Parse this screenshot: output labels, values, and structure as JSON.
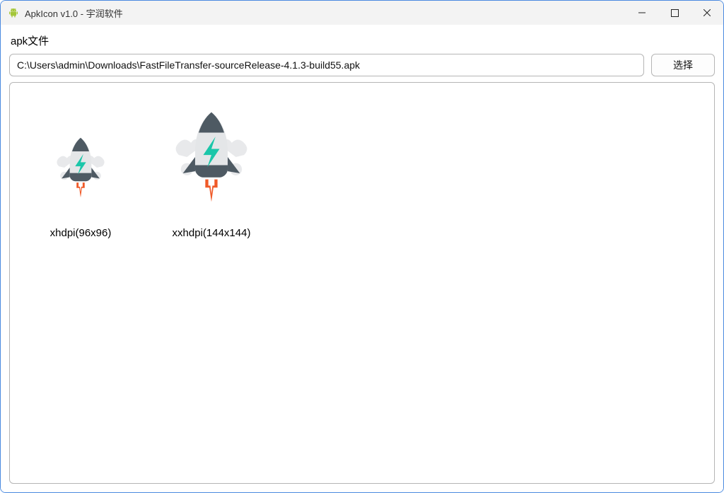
{
  "titlebar": {
    "title": "ApkIcon v1.0 - 宇润软件"
  },
  "form": {
    "file_label": "apk文件",
    "path_value": "C:\\Users\\admin\\Downloads\\FastFileTransfer-sourceRelease-4.1.3-build55.apk",
    "choose_label": "选择"
  },
  "icons": [
    {
      "slot_class": "sz96",
      "svg_size": 96,
      "caption": "xhdpi(96x96)"
    },
    {
      "slot_class": "sz144",
      "svg_size": 144,
      "caption": "xxhdpi(144x144)"
    }
  ],
  "rocket_colors": {
    "body_light": "#E4E6E8",
    "body_dark": "#4E5A63",
    "bolt": "#1BC6A9",
    "fin": "#4E5A63",
    "flame_outer": "#F05A28",
    "flame_inner": "#FFFFFF",
    "smoke": "#E4E6E8"
  }
}
